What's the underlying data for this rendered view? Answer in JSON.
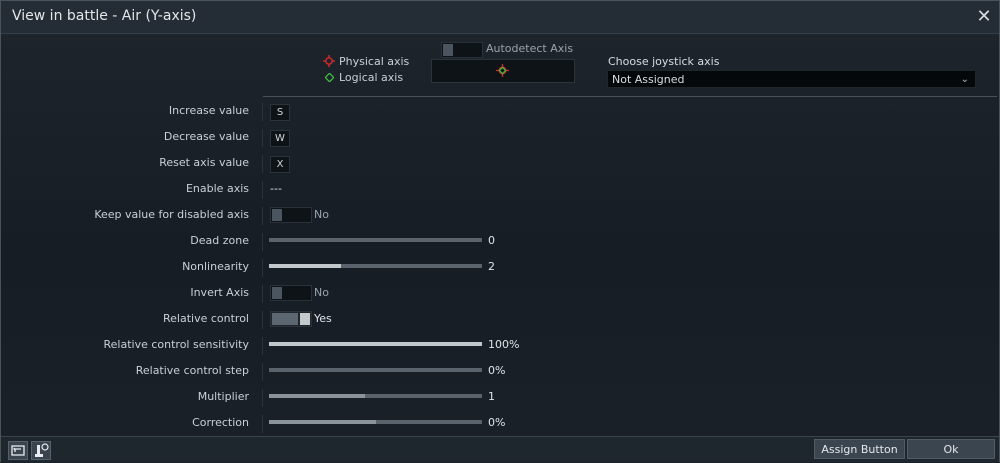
{
  "window": {
    "title": "View in battle - Air (Y-axis)"
  },
  "header": {
    "physical_axis": "Physical axis",
    "logical_axis": "Logical axis",
    "autodetect_label": "Autodetect Axis",
    "choose_joystick_label": "Choose joystick axis",
    "joystick_value": "Not Assigned",
    "colors": {
      "physical": "#d42a2a",
      "logical": "#3fbf3f"
    }
  },
  "rows": {
    "increase": {
      "label": "Increase value",
      "key": "S"
    },
    "decrease": {
      "label": "Decrease value",
      "key": "W"
    },
    "reset": {
      "label": "Reset axis value",
      "key": "X"
    },
    "enable": {
      "label": "Enable axis",
      "value": "---"
    },
    "keep": {
      "label": "Keep value for disabled axis",
      "value": "No",
      "on": false
    },
    "deadzone": {
      "label": "Dead zone",
      "value": "0",
      "level": 0
    },
    "nonlinearity": {
      "label": "Nonlinearity",
      "value": "2",
      "level": 0.34
    },
    "invert": {
      "label": "Invert Axis",
      "value": "No",
      "on": false
    },
    "relative": {
      "label": "Relative control",
      "value": "Yes",
      "on": true
    },
    "rel_sens": {
      "label": "Relative control sensitivity",
      "value": "100%",
      "level": 1.0
    },
    "rel_step": {
      "label": "Relative control step",
      "value": "0%",
      "level": 0
    },
    "multiplier": {
      "label": "Multiplier",
      "value": "1",
      "level": 0.45
    },
    "correction": {
      "label": "Correction",
      "value": "0%",
      "level": 0.5
    }
  },
  "footer": {
    "assign_button": "Assign Button",
    "ok_button": "Ok"
  }
}
